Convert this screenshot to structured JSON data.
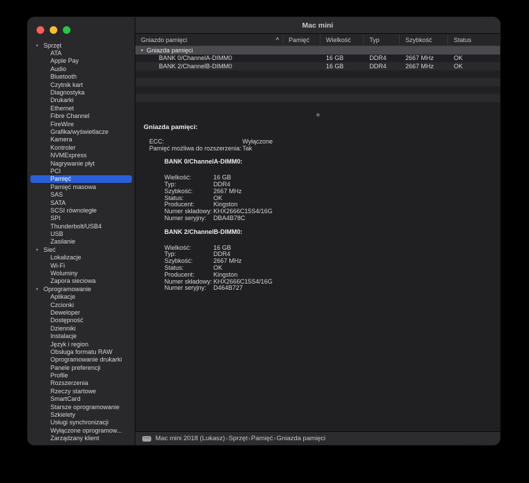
{
  "window": {
    "title": "Mac mini"
  },
  "colors": {
    "accent": "#2a5fd9",
    "traffic_close": "#ff5f57",
    "traffic_minimize": "#febc2e",
    "traffic_zoom": "#28c840"
  },
  "icons": {
    "chevron_down": "▾",
    "sort_ascending": "^"
  },
  "sidebar": {
    "selected": "Pamięć",
    "sections": [
      {
        "label": "Sprzęt",
        "items": [
          "ATA",
          "Apple Pay",
          "Audio",
          "Bluetooth",
          "Czytnik kart",
          "Diagnostyka",
          "Drukarki",
          "Ethernet",
          "Fibre Channel",
          "FireWire",
          "Grafika/wyświetlacze",
          "Kamera",
          "Kontroler",
          "NVMExpress",
          "Nagrywanie płyt",
          "PCI",
          "Pamięć",
          "Pamięć masowa",
          "SAS",
          "SATA",
          "SCSI równoległe",
          "SPI",
          "Thunderbolt/USB4",
          "USB",
          "Zasilanie"
        ]
      },
      {
        "label": "Sieć",
        "items": [
          "Lokalizacje",
          "Wi-Fi",
          "Woluminy",
          "Zapora sieciowa"
        ]
      },
      {
        "label": "Oprogramowanie",
        "items": [
          "Aplikacje",
          "Czcionki",
          "Deweloper",
          "Dostępność",
          "Dzienniki",
          "Instalacje",
          "Język i region",
          "Obsługa formatu RAW",
          "Oprogramowanie drukarki",
          "Panele preferencji",
          "Profile",
          "Rozszerzenia",
          "Rzeczy startowe",
          "SmartCard",
          "Starsze oprogramowanie",
          "Szkielety",
          "Usługi synchronizacji",
          "Wyłączone oprogramow...",
          "Zarządzany klient"
        ]
      }
    ]
  },
  "table": {
    "columns": [
      "Gniazdo pamięci",
      "Pamięć",
      "Wielkość",
      "Typ",
      "Szybkość",
      "Status"
    ],
    "group": "Gniazda pamięci",
    "rows": [
      {
        "slot": "BANK 0/ChannelA-DIMM0",
        "memory": "",
        "size": "16 GB",
        "type": "DDR4",
        "speed": "2667 MHz",
        "status": "OK"
      },
      {
        "slot": "BANK 2/ChannelB-DIMM0",
        "memory": "",
        "size": "16 GB",
        "type": "DDR4",
        "speed": "2667 MHz",
        "status": "OK"
      }
    ]
  },
  "details": {
    "heading": "Gniazda pamięci:",
    "global": [
      {
        "label": "ECC:",
        "value": "Wyłączone"
      },
      {
        "label": "Pamięć możliwa do rozszerzenia:",
        "value": "Tak"
      }
    ],
    "banks": [
      {
        "heading": "BANK 0/ChannelA-DIMM0:",
        "fields": [
          {
            "label": "Wielkość:",
            "value": "16 GB"
          },
          {
            "label": "Typ:",
            "value": "DDR4"
          },
          {
            "label": "Szybkość:",
            "value": "2667 MHz"
          },
          {
            "label": "Status:",
            "value": "OK"
          },
          {
            "label": "Producent:",
            "value": "Kingston"
          },
          {
            "label": "Numer składowy:",
            "value": "KHX2666C15S4/16G"
          },
          {
            "label": "Numer seryjny:",
            "value": "DBA4B78C"
          }
        ]
      },
      {
        "heading": "BANK 2/ChannelB-DIMM0:",
        "fields": [
          {
            "label": "Wielkość:",
            "value": "16 GB"
          },
          {
            "label": "Typ:",
            "value": "DDR4"
          },
          {
            "label": "Szybkość:",
            "value": "2667 MHz"
          },
          {
            "label": "Status:",
            "value": "OK"
          },
          {
            "label": "Producent:",
            "value": "Kingston"
          },
          {
            "label": "Numer składowy:",
            "value": "KHX2666C15S4/16G"
          },
          {
            "label": "Numer seryjny:",
            "value": "D464B727"
          }
        ]
      }
    ]
  },
  "statusbar": {
    "separator": "›",
    "segments": [
      "Mac mini 2018 (Lukasz)",
      "Sprzęt",
      "Pamięć",
      "Gniazda pamięci"
    ]
  }
}
